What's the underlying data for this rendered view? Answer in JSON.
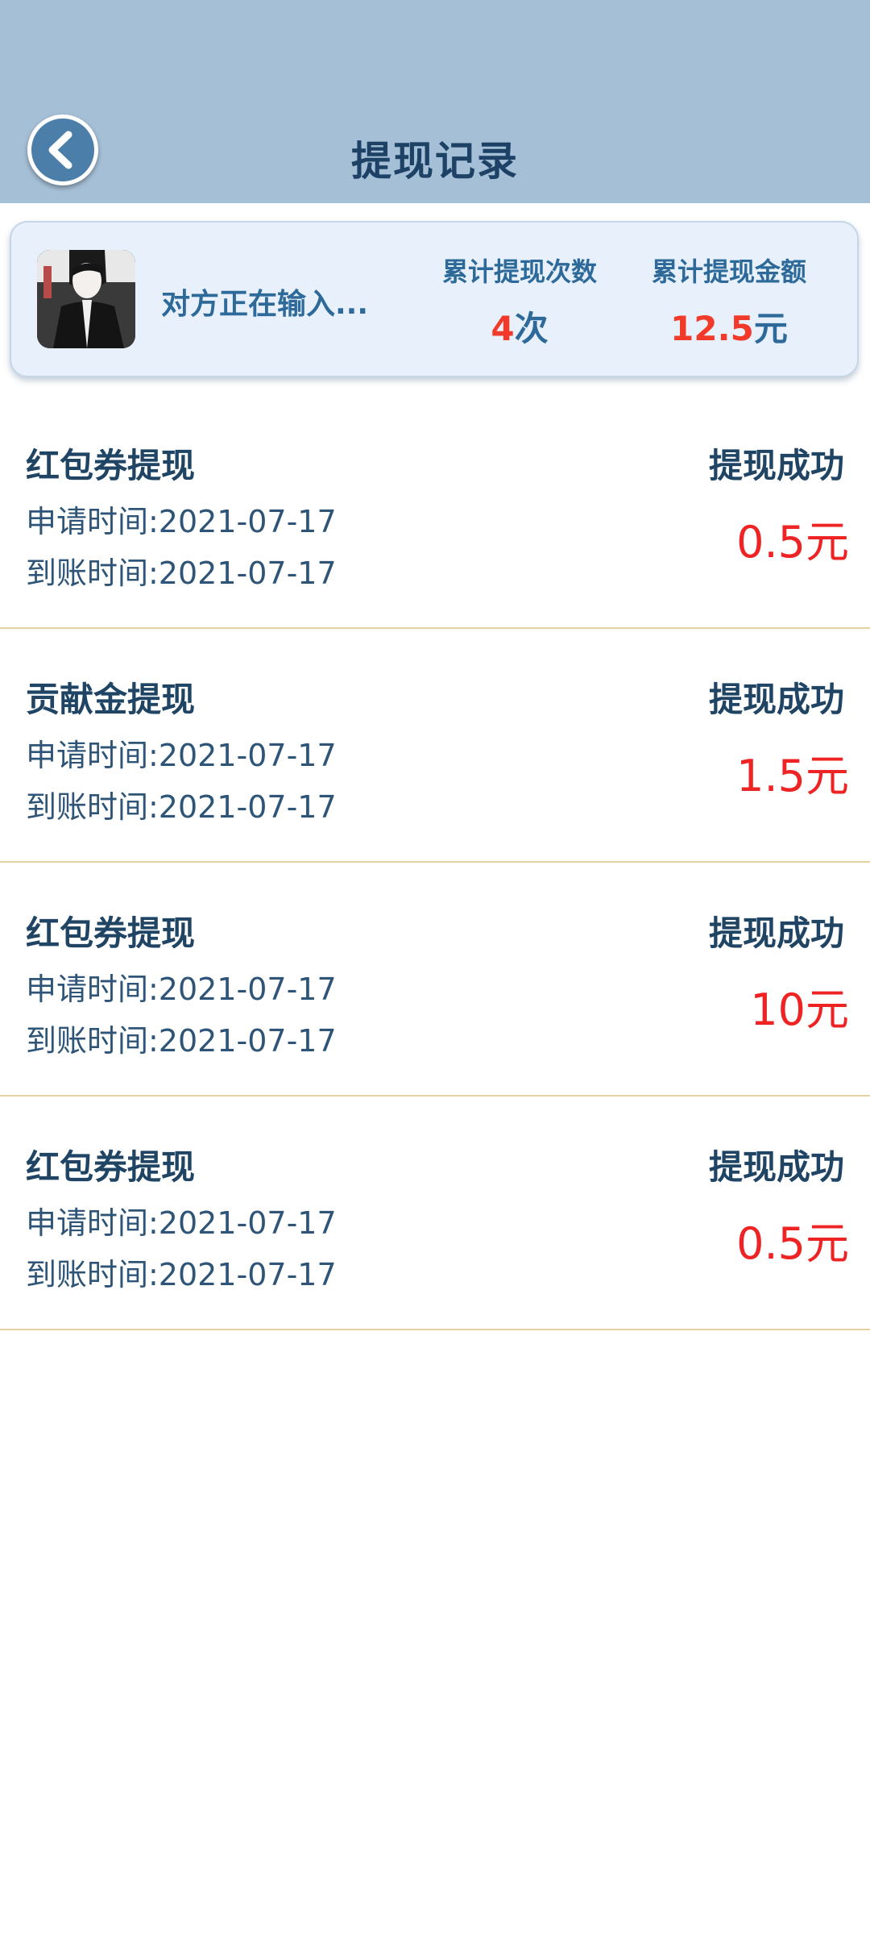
{
  "header": {
    "title": "提现记录",
    "back_icon": "chevron-left-icon"
  },
  "summary": {
    "nickname": "对方正在输入...",
    "count_label": "累计提现次数",
    "count_value": "4",
    "count_unit": "次",
    "amount_label": "累计提现金额",
    "amount_value": "12.5",
    "amount_unit": "元"
  },
  "records": [
    {
      "type": "红包券提现",
      "status": "提现成功",
      "apply_time": "申请时间:2021-07-17",
      "arrive_time": "到账时间:2021-07-17",
      "amount": "0.5元"
    },
    {
      "type": "贡献金提现",
      "status": "提现成功",
      "apply_time": "申请时间:2021-07-17",
      "arrive_time": "到账时间:2021-07-17",
      "amount": "1.5元"
    },
    {
      "type": "红包券提现",
      "status": "提现成功",
      "apply_time": "申请时间:2021-07-17",
      "arrive_time": "到账时间:2021-07-17",
      "amount": "10元"
    },
    {
      "type": "红包券提现",
      "status": "提现成功",
      "apply_time": "申请时间:2021-07-17",
      "arrive_time": "到账时间:2021-07-17",
      "amount": "0.5元"
    }
  ],
  "colors": {
    "header_bg": "#a5bfd6",
    "title": "#1d4266",
    "accent_red": "#ee2424",
    "divider": "#e6cfa1"
  }
}
